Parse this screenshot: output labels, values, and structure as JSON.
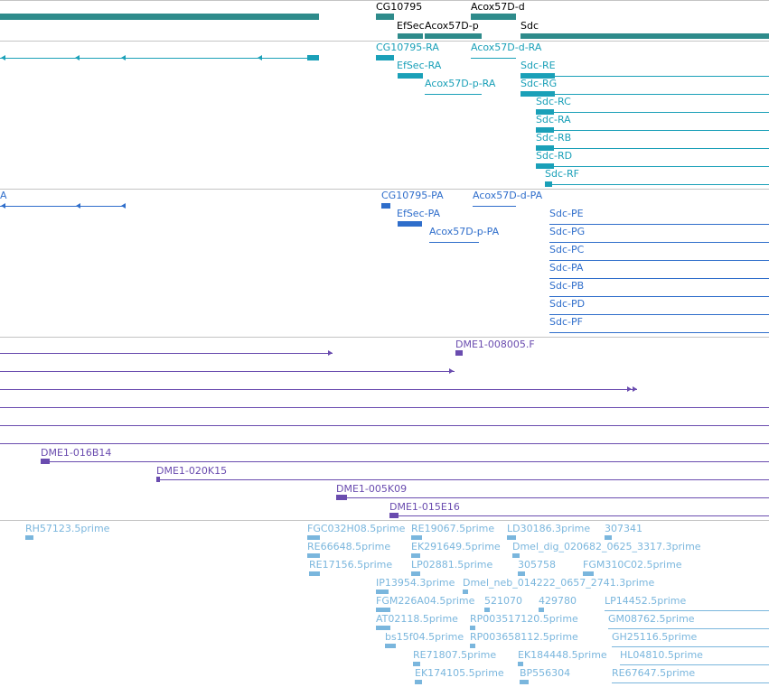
{
  "colors": {
    "gene": "#2e8b8b",
    "rna": "#1aa0b8",
    "protein": "#2f6ecb",
    "clone": "#6a4caf",
    "est": "#7ab6dd",
    "separator": "#c4c4c4"
  },
  "tracks": {
    "genes": {
      "labels": [
        "CG10795",
        "Acox57D-d",
        "EfSec",
        "Acox57D-p",
        "Sdc"
      ]
    },
    "rnas": {
      "labels": [
        "CG10795-RA",
        "Acox57D-d-RA",
        "EfSec-RA",
        "Sdc-RE",
        "Acox57D-p-RA",
        "Sdc-RG",
        "Sdc-RC",
        "Sdc-RA",
        "Sdc-RB",
        "Sdc-RD",
        "Sdc-RF"
      ]
    },
    "proteins": {
      "labels": [
        "A",
        "CG10795-PA",
        "Acox57D-d-PA",
        "EfSec-PA",
        "Sdc-PE",
        "Acox57D-p-PA",
        "Sdc-PG",
        "Sdc-PC",
        "Sdc-PA",
        "Sdc-PB",
        "Sdc-PD",
        "Sdc-PF"
      ]
    },
    "clones": {
      "labels": [
        "DME1-008005.F",
        "DME1-016B14",
        "DME1-020K15",
        "DME1-005K09",
        "DME1-015E16"
      ]
    },
    "ests": {
      "labels": [
        "RH57123.5prime",
        "FGC032H08.5prime",
        "RE19067.5prime",
        "LD30186.3prime",
        "307341",
        "RE66648.5prime",
        "EK291649.5prime",
        "Dmel_dig_020682_0625_3317.3prime",
        "RE17156.5prime",
        "LP02881.5prime",
        "305758",
        "FGM310C02.5prime",
        "IP13954.3prime",
        "Dmel_neb_014222_0657_2741.3prime",
        "FGM226A04.5prime",
        "521070",
        "429780",
        "LP14452.5prime",
        "AT02118.5prime",
        "RP003517120.5prime",
        "GM08762.5prime",
        "bs15f04.5prime",
        "RP003658112.5prime",
        "GH25116.5prime",
        "RE71807.5prime",
        "EK184448.5prime",
        "HL04810.5prime",
        "EK174105.5prime",
        "BP556304",
        "RE67647.5prime"
      ]
    }
  }
}
